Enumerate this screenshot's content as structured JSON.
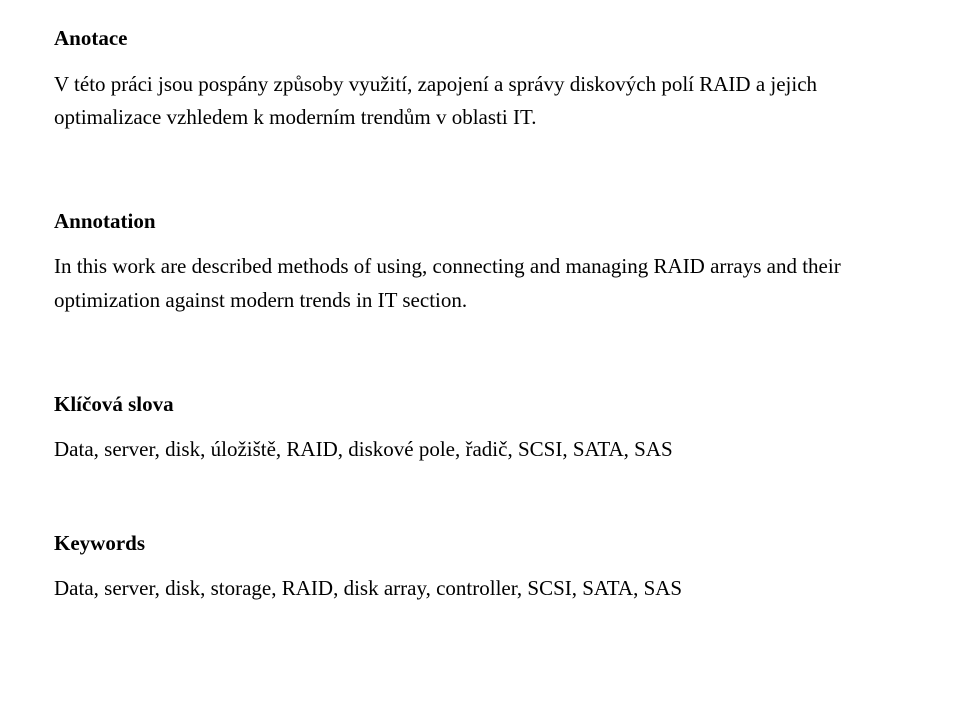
{
  "anotace": {
    "heading": "Anotace",
    "body": "V této práci jsou pospány způsoby využití, zapojení a správy diskových polí RAID a jejich optimalizace vzhledem k moderním trendům v oblasti IT."
  },
  "annotation": {
    "heading": "Annotation",
    "body": "In this work are described methods of using, connecting and managing RAID arrays and their optimization against modern trends in IT section."
  },
  "klicova": {
    "heading": "Klíčová slova",
    "body": "Data, server, disk, úložiště, RAID, diskové pole, řadič, SCSI, SATA, SAS"
  },
  "keywords": {
    "heading": "Keywords",
    "body": "Data, server, disk, storage, RAID, disk array, controller, SCSI, SATA, SAS"
  }
}
